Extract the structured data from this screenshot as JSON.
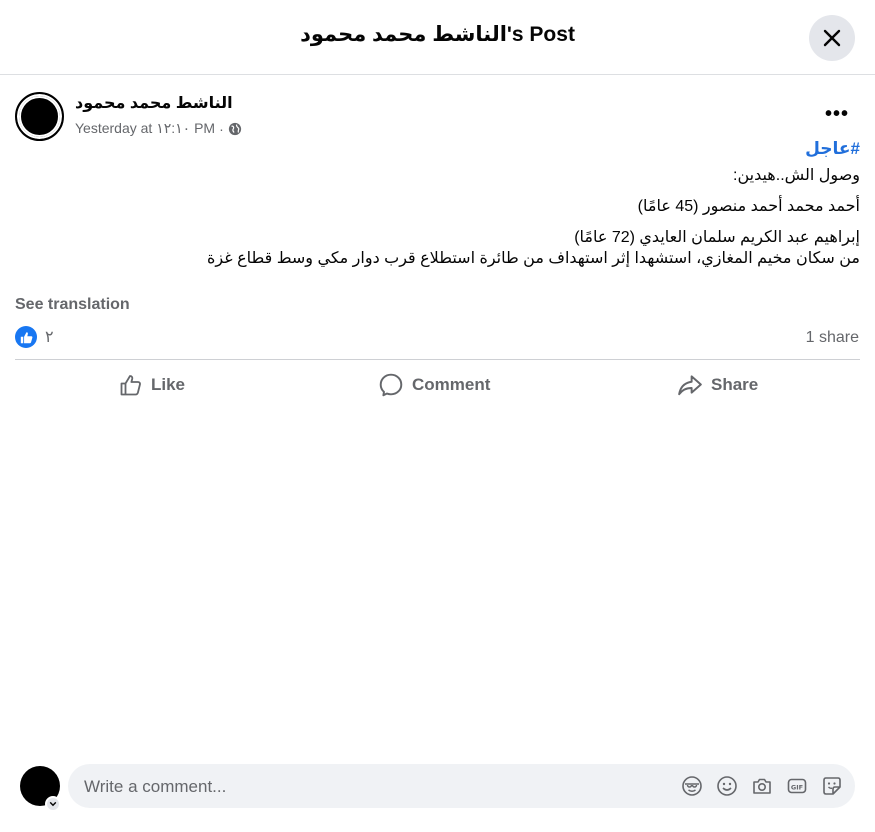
{
  "header": {
    "title": "الناشط محمد محمود's Post"
  },
  "post": {
    "author": "الناشط محمد محمود",
    "time": "Yesterday at ١٢:١٠ PM",
    "meta_separator": "·",
    "more_label": "•••",
    "hashtag": "#عاجل",
    "lines": [
      "وصول الش..هيدين:",
      "أحمد محمد أحمد منصور (45 عامًا)",
      "إبراهيم عبد الكريم سلمان العايدي (72 عامًا)",
      "من سكان مخيم المغازي، استشهدا إثر استهداف من طائرة استطلاع قرب دوار مكي وسط قطاع غزة"
    ],
    "see_translation": "See translation",
    "reaction_count": "٢",
    "shares": "1 share"
  },
  "actions": {
    "like": "Like",
    "comment": "Comment",
    "share": "Share"
  },
  "comment_box": {
    "placeholder": "Write a comment..."
  },
  "colors": {
    "link": "#216fdb",
    "like_blue": "#1877f2",
    "muted": "#65676b"
  }
}
